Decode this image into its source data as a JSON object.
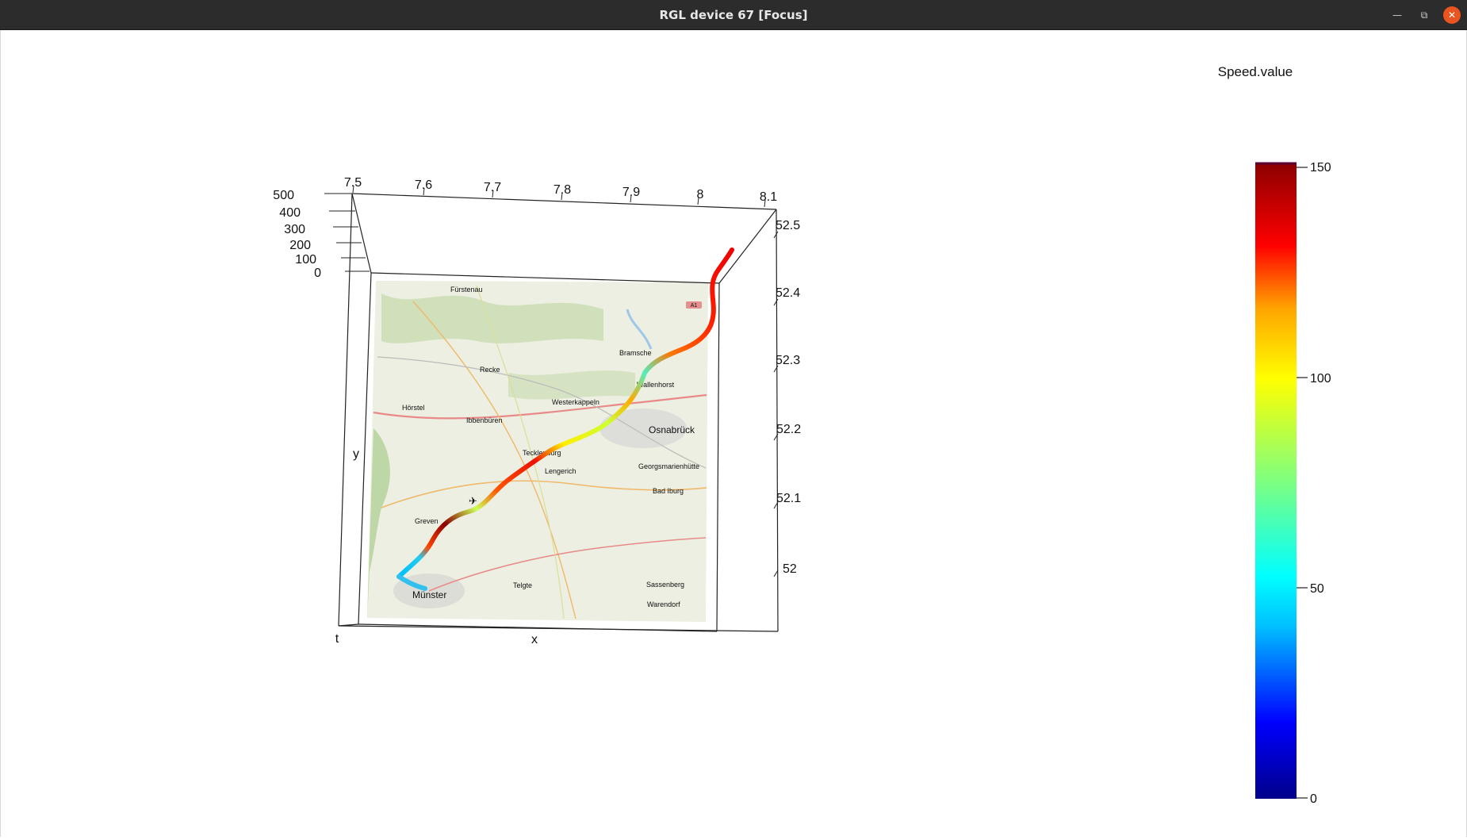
{
  "window": {
    "title": "RGL device 67 [Focus]",
    "controls": {
      "minimize_icon": "minimize-icon",
      "maximize_icon": "restore-icon",
      "close_icon": "close-icon"
    }
  },
  "plot": {
    "axis_labels": {
      "x": "x",
      "y": "y",
      "t": "t"
    },
    "x_ticks": [
      "7.5",
      "7.6",
      "7.7",
      "7.8",
      "7.9",
      "8",
      "8.1"
    ],
    "y_ticks": [
      "52.5",
      "52.4",
      "52.3",
      "52.2",
      "52.1",
      "52"
    ],
    "t_ticks": [
      "500",
      "400",
      "300",
      "200",
      "100",
      "0"
    ],
    "map_places": [
      "Fürstenau",
      "Bramsche",
      "Recke",
      "Wallenhorst",
      "Westerkappeln",
      "Hörstel",
      "Ibbenbüren",
      "Osnabrück",
      "Tecklenburg",
      "Georgsmarienhütte",
      "Lengerich",
      "Bad Iburg",
      "Greven",
      "Münster",
      "Telgte",
      "Sassenberg",
      "Warendorf",
      "A1"
    ]
  },
  "legend": {
    "title": "Speed.value",
    "ticks": [
      "150",
      "100",
      "50",
      "0"
    ],
    "range": [
      0,
      150
    ],
    "colors": [
      "#00008b",
      "#0000ff",
      "#00bfff",
      "#00ffff",
      "#7fff7f",
      "#ffff00",
      "#ffa500",
      "#ff0000",
      "#8b0000"
    ]
  },
  "colors": {
    "titlebar": "#2c2c2c",
    "close_button": "#e95420",
    "map_land": "#ecefe1"
  }
}
